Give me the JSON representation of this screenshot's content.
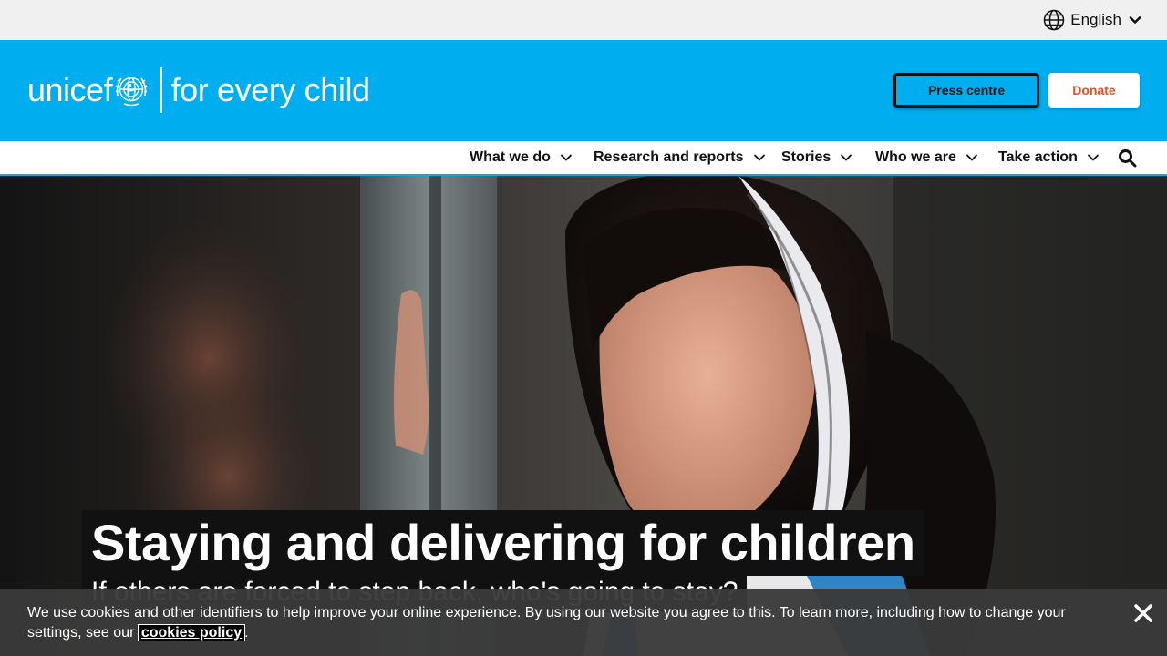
{
  "topbar": {
    "language_label": "English",
    "globe_icon": "globe-icon",
    "chevron_icon": "chevron-down-icon"
  },
  "brand": {
    "logo_word": "unicef",
    "tagline": "for every child",
    "emblem_icon": "unicef-emblem-icon"
  },
  "header": {
    "press_label": "Press centre",
    "donate_label": "Donate"
  },
  "nav": {
    "items": [
      {
        "label": "What we do"
      },
      {
        "label": "Research and reports"
      },
      {
        "label": "Stories"
      },
      {
        "label": "Who we are"
      },
      {
        "label": "Take action"
      }
    ],
    "search_icon": "search-icon"
  },
  "hero": {
    "title": "Staying and delivering for children",
    "subtitle": "If others are forced to step back, who's going to stay?"
  },
  "cookie": {
    "text_before": "We use cookies and other identifiers to help improve your online experience. By using our website you agree to this. To learn more, including how to change your settings, see our ",
    "link_label": "cookies policy",
    "text_after": ".",
    "close_icon": "close-icon"
  },
  "colors": {
    "brand_blue": "#00aeef",
    "donate_orange": "#e2521c",
    "topbar_gray": "#f0f0f0",
    "cookie_bg": "#3a3a3a"
  }
}
